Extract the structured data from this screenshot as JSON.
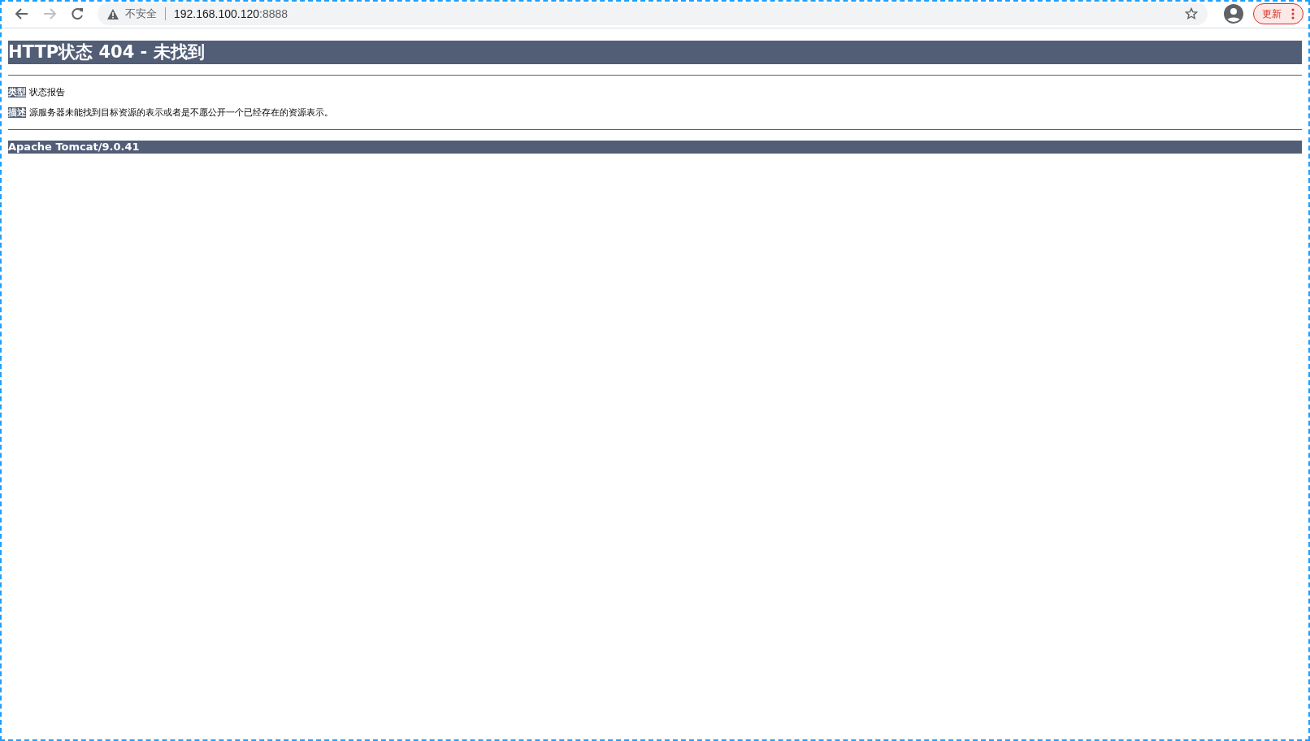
{
  "browser": {
    "security_label": "不安全",
    "url_host": "192.168.100.120",
    "url_port": ":8888",
    "update_button": "更新"
  },
  "page": {
    "title": "HTTP状态 404 - 未找到",
    "fields": [
      {
        "label": "类型",
        "value": "状态报告"
      },
      {
        "label": "描述",
        "value": "源服务器未能找到目标资源的表示或者是不愿公开一个已经存在的资源表示。"
      }
    ],
    "footer": "Apache Tomcat/9.0.41"
  }
}
